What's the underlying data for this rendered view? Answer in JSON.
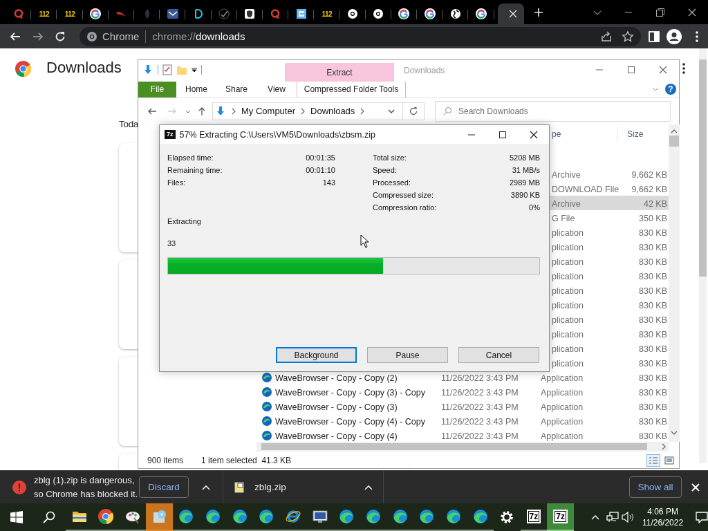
{
  "chrome": {
    "tabs": [
      {
        "kind": "q",
        "selected": false
      },
      {
        "kind": "text",
        "label": "112",
        "selected": false
      },
      {
        "kind": "text",
        "label": "112",
        "selected": false
      },
      {
        "kind": "g",
        "selected": false
      },
      {
        "kind": "swoosh",
        "selected": false
      },
      {
        "kind": "dim",
        "selected": false
      },
      {
        "kind": "mail",
        "selected": false
      },
      {
        "kind": "d",
        "selected": false
      },
      {
        "kind": "check",
        "selected": false
      },
      {
        "kind": "shield",
        "selected": false
      },
      {
        "kind": "q",
        "selected": false
      },
      {
        "kind": "tile",
        "selected": false
      },
      {
        "kind": "text",
        "label": "112",
        "selected": false
      },
      {
        "kind": "aperture",
        "selected": false
      },
      {
        "kind": "aperture",
        "selected": false
      },
      {
        "kind": "g",
        "selected": false
      },
      {
        "kind": "g",
        "selected": false
      },
      {
        "kind": "globe",
        "selected": false
      },
      {
        "kind": "g",
        "selected": false
      },
      {
        "kind": "blank",
        "selected": true
      }
    ],
    "omnibox": {
      "chip": "Chrome",
      "url": "chrome://**downloads**"
    }
  },
  "page": {
    "title": "Downloads",
    "section": "Toda",
    "cards": [
      {
        "kind": "download"
      },
      {
        "kind": "download"
      },
      {
        "kind": "download"
      },
      {
        "kind": "download"
      }
    ]
  },
  "explorer": {
    "title": "Downloads",
    "context_tab": "Extract",
    "ribbon_tabs": [
      {
        "label": "File",
        "kind": "file"
      },
      {
        "label": "Home",
        "kind": "tab"
      },
      {
        "label": "Share",
        "kind": "tab"
      },
      {
        "label": "View",
        "kind": "tab"
      },
      {
        "label": "Compressed Folder Tools",
        "kind": "context"
      }
    ],
    "help": "?",
    "breadcrumb": [
      "My Computer",
      "Downloads"
    ],
    "search": {
      "placeholder": "Search Downloads"
    },
    "columns": [
      {
        "label": "pe",
        "kind": "partial"
      },
      {
        "label": "Size",
        "kind": "full"
      }
    ],
    "rows": [
      {
        "kind": "partial",
        "type": "Archive",
        "size": "9,662 KB",
        "selected": false
      },
      {
        "kind": "partial",
        "type": "DOWNLOAD File",
        "size": "9,662 KB",
        "selected": false
      },
      {
        "kind": "partial",
        "type": "Archive",
        "size": "42 KB",
        "selected": true
      },
      {
        "kind": "partial",
        "type": "G File",
        "size": "350 KB",
        "selected": false
      },
      {
        "kind": "partial",
        "type": "plication",
        "size": "830 KB",
        "selected": false
      },
      {
        "kind": "partial",
        "type": "plication",
        "size": "830 KB",
        "selected": false
      },
      {
        "kind": "partial",
        "type": "plication",
        "size": "830 KB",
        "selected": false
      },
      {
        "kind": "partial",
        "type": "plication",
        "size": "830 KB",
        "selected": false
      },
      {
        "kind": "partial",
        "type": "plication",
        "size": "830 KB",
        "selected": false
      },
      {
        "kind": "partial",
        "type": "plication",
        "size": "830 KB",
        "selected": false
      },
      {
        "kind": "partial",
        "type": "plication",
        "size": "830 KB",
        "selected": false
      },
      {
        "kind": "partial",
        "type": "plication",
        "size": "830 KB",
        "selected": false
      },
      {
        "kind": "partial",
        "type": "plication",
        "size": "830 KB",
        "selected": false
      },
      {
        "kind": "partial",
        "type": "plication",
        "size": "830 KB",
        "selected": false
      },
      {
        "kind": "full",
        "name": "WaveBrowser - Copy - Copy (2)",
        "date": "11/26/2022 3:43 PM",
        "type": "Application",
        "size": "830 KB",
        "selected": false
      },
      {
        "kind": "full",
        "name": "WaveBrowser - Copy - Copy (3) - Copy",
        "date": "11/26/2022 3:43 PM",
        "type": "Application",
        "size": "830 KB",
        "selected": false
      },
      {
        "kind": "full",
        "name": "WaveBrowser - Copy - Copy (3)",
        "date": "11/26/2022 3:43 PM",
        "type": "Application",
        "size": "830 KB",
        "selected": false
      },
      {
        "kind": "full",
        "name": "WaveBrowser - Copy - Copy (4) - Copy",
        "date": "11/26/2022 3:43 PM",
        "type": "Application",
        "size": "830 KB",
        "selected": false
      },
      {
        "kind": "full",
        "name": "WaveBrowser - Copy - Copy (4)",
        "date": "11/26/2022 3:43 PM",
        "type": "Application",
        "size": "830 KB",
        "selected": false
      }
    ],
    "status": {
      "count": "900 items",
      "selection": "1 item selected  41.3 KB"
    },
    "views": [
      {
        "kind": "details",
        "selected": true
      },
      {
        "kind": "thumbnails",
        "selected": false
      }
    ]
  },
  "dialog": {
    "icon_label": "7z",
    "title": "57% Extracting C:\\Users\\VM5\\Downloads\\zbsm.zip",
    "left_stats": [
      {
        "label": "Elapsed time:",
        "value": "00:01:35"
      },
      {
        "label": "Remaining time:",
        "value": "00:01:10"
      },
      {
        "label": "Files:",
        "value": "143"
      }
    ],
    "right_stats": [
      {
        "label": "Total size:",
        "value": "5208 MB"
      },
      {
        "label": "Speed:",
        "value": "31 MB/s"
      },
      {
        "label": "Processed:",
        "value": "2989 MB"
      },
      {
        "label": "Compressed size:",
        "value": "3890 KB"
      },
      {
        "label": "Compression ratio:",
        "value": "0%"
      }
    ],
    "status": "Extracting",
    "current": "33",
    "progress": {
      "level": 0.58
    },
    "buttons": [
      {
        "label": "Background",
        "focused": true
      },
      {
        "label": "Pause",
        "focused": false
      },
      {
        "label": "Cancel",
        "focused": false
      }
    ]
  },
  "shelf": {
    "warning": "zblg (1).zip is dangerous,\nso Chrome has blocked it.",
    "discard": "Discard",
    "file": "zblg.zip",
    "show_all": "Show all"
  },
  "taskbar": {
    "items": [
      {
        "kind": "folder",
        "running": true,
        "flashing": false,
        "selected": false
      },
      {
        "kind": "browser",
        "running": true,
        "flashing": false,
        "selected": false
      },
      {
        "kind": "paint",
        "running": true,
        "flashing": false,
        "selected": false
      },
      {
        "kind": "installer",
        "running": true,
        "flashing": true,
        "selected": false
      },
      {
        "kind": "edge",
        "running": true,
        "flashing": false,
        "selected": false
      },
      {
        "kind": "edge",
        "running": true,
        "flashing": false,
        "selected": false
      },
      {
        "kind": "edge",
        "running": true,
        "flashing": false,
        "selected": false
      },
      {
        "kind": "edge",
        "running": true,
        "flashing": false,
        "selected": false
      },
      {
        "kind": "ie",
        "running": true,
        "flashing": false,
        "selected": false
      },
      {
        "kind": "monitor",
        "running": true,
        "flashing": false,
        "selected": false
      },
      {
        "kind": "edge",
        "running": true,
        "flashing": false,
        "selected": false
      },
      {
        "kind": "edge",
        "running": true,
        "flashing": false,
        "selected": false
      },
      {
        "kind": "edge",
        "running": true,
        "flashing": false,
        "selected": false
      },
      {
        "kind": "edge",
        "running": true,
        "flashing": false,
        "selected": false
      },
      {
        "kind": "edge",
        "running": true,
        "flashing": false,
        "selected": false
      },
      {
        "kind": "edge",
        "running": true,
        "flashing": false,
        "selected": false
      },
      {
        "kind": "gear",
        "running": false,
        "flashing": false,
        "selected": false
      },
      {
        "kind": "sevenzip",
        "label": "7z",
        "running": true,
        "flashing": false,
        "selected": false
      },
      {
        "kind": "sevenzip",
        "label": "7z",
        "running": true,
        "flashing": false,
        "selected": true
      }
    ],
    "time": "4:06 PM",
    "date": "11/26/2022"
  }
}
